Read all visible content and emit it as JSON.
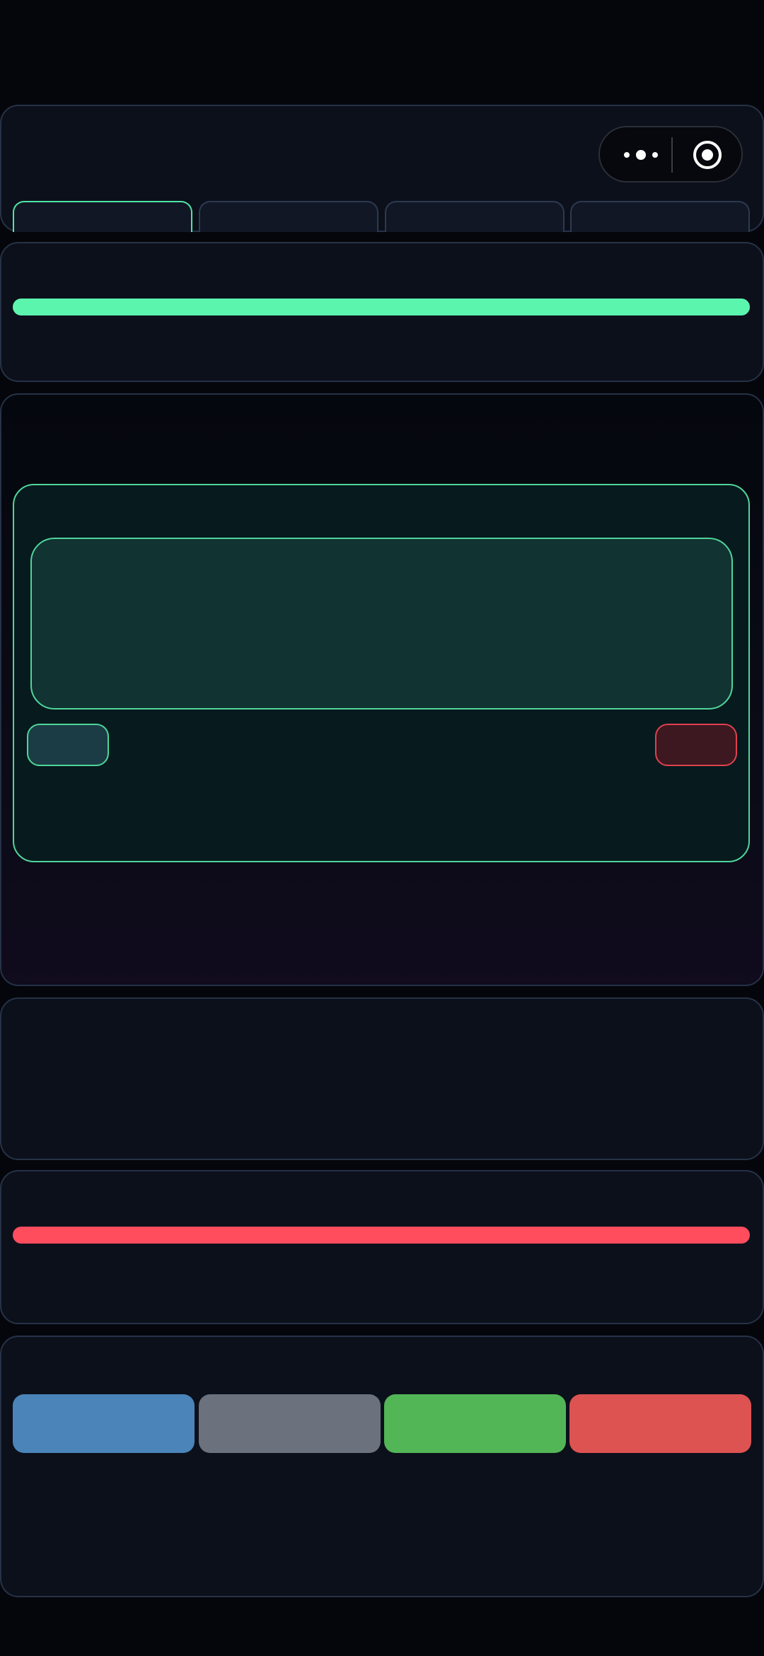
{
  "window": {
    "capsule": {
      "menu_icon": "more-dots-icon",
      "close_icon": "target-circle-icon"
    }
  },
  "tabs": [
    {
      "label": "",
      "active": true
    },
    {
      "label": "",
      "active": false
    },
    {
      "label": "",
      "active": false
    },
    {
      "label": "",
      "active": false
    }
  ],
  "progress": {
    "fraction": 1.0,
    "color": "#5cf5ae"
  },
  "editor": {
    "accent": "#4fd69a",
    "input_value": "",
    "left_button_label": "",
    "right_button_label": ""
  },
  "danger": {
    "fraction": 1.0,
    "color": "#ff4d5e"
  },
  "actions": [
    {
      "label": "",
      "color": "#4a84b8"
    },
    {
      "label": "",
      "color": "#6b727d"
    },
    {
      "label": "",
      "color": "#52b656"
    },
    {
      "label": "",
      "color": "#dc5352"
    }
  ]
}
